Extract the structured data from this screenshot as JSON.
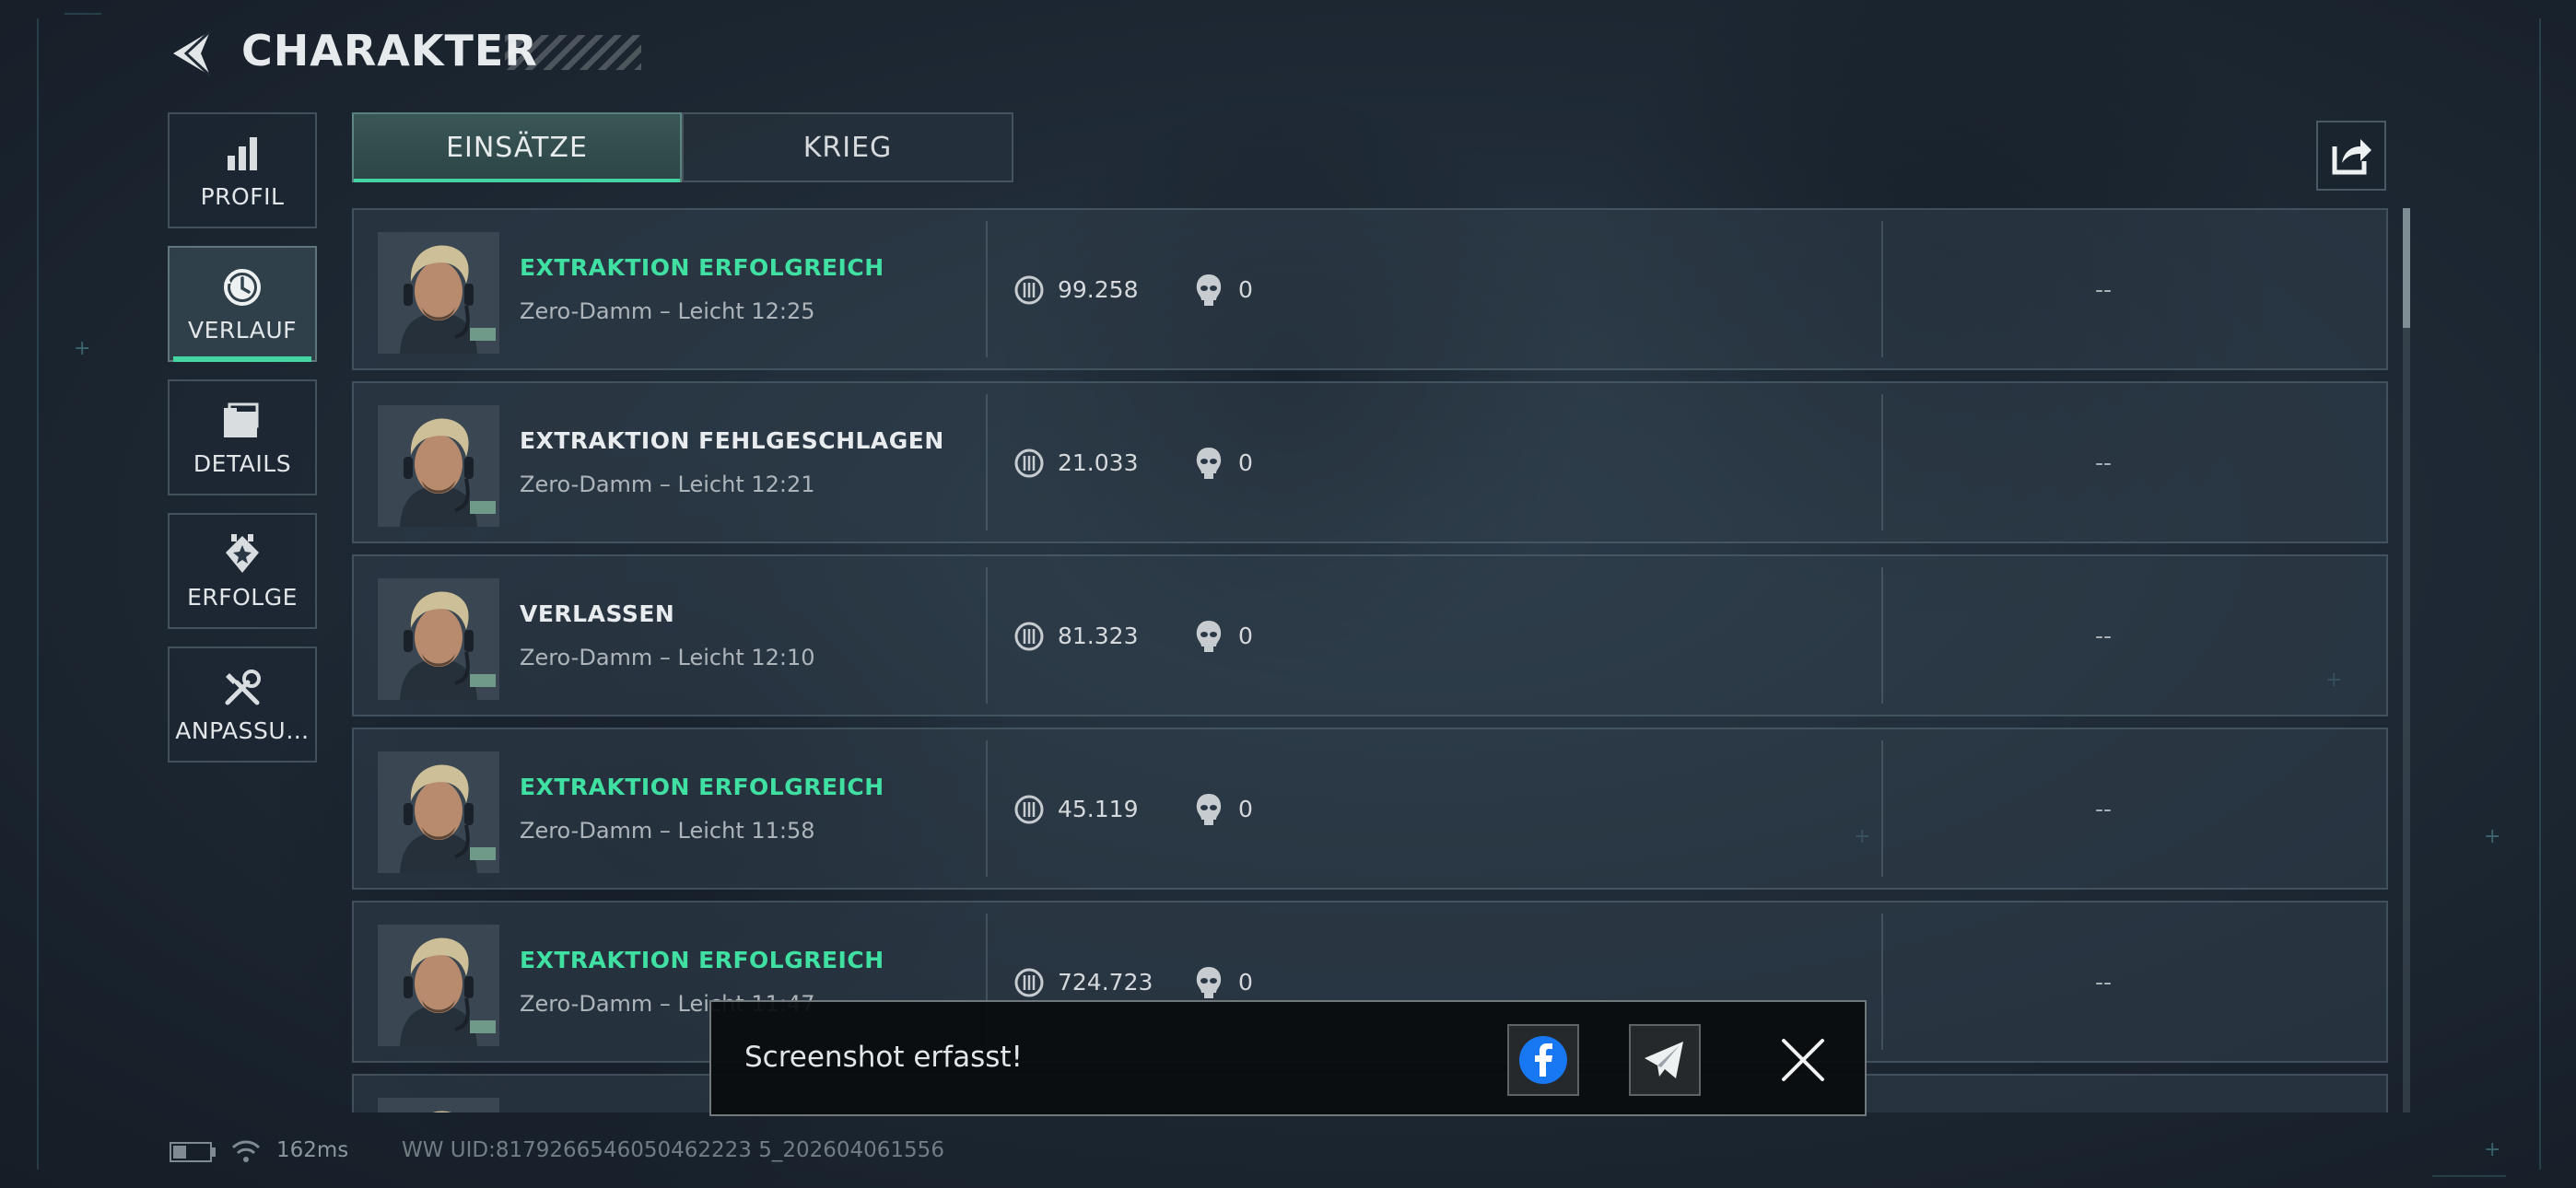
{
  "header": {
    "title": "CHARAKTER"
  },
  "sidebar": {
    "items": [
      {
        "label": "PROFIL",
        "icon": "bar-chart-icon",
        "active": false
      },
      {
        "label": "VERLAUF",
        "icon": "history-clock-icon",
        "active": true
      },
      {
        "label": "DETAILS",
        "icon": "folders-icon",
        "active": false
      },
      {
        "label": "ERFOLGE",
        "icon": "achievement-badge-icon",
        "active": false
      },
      {
        "label": "ANPASSU…",
        "icon": "wrench-screwdriver-icon",
        "active": false
      }
    ]
  },
  "tabs": [
    {
      "label": "EINSÄTZE",
      "active": true
    },
    {
      "label": "KRIEG",
      "active": false
    }
  ],
  "share": {
    "icon": "share-export-icon"
  },
  "matches": [
    {
      "status": "EXTRAKTION ERFOLGREICH",
      "status_type": "success",
      "subtitle": "Zero-Damm – Leicht 12:25",
      "value": "99.258",
      "kills": "0",
      "extra": "--"
    },
    {
      "status": "EXTRAKTION FEHLGESCHLAGEN",
      "status_type": "failed",
      "subtitle": "Zero-Damm – Leicht 12:21",
      "value": "21.033",
      "kills": "0",
      "extra": "--"
    },
    {
      "status": "VERLASSEN",
      "status_type": "left",
      "subtitle": "Zero-Damm – Leicht 12:10",
      "value": "81.323",
      "kills": "0",
      "extra": "--"
    },
    {
      "status": "EXTRAKTION ERFOLGREICH",
      "status_type": "success",
      "subtitle": "Zero-Damm – Leicht 11:58",
      "value": "45.119",
      "kills": "0",
      "extra": "--"
    },
    {
      "status": "EXTRAKTION ERFOLGREICH",
      "status_type": "success",
      "subtitle": "Zero-Damm – Leicht 11:47",
      "value": "724.723",
      "kills": "0",
      "extra": "--"
    }
  ],
  "toast": {
    "message": "Screenshot erfasst!",
    "buttons": [
      "facebook-icon",
      "telegram-icon",
      "close-icon"
    ]
  },
  "footer": {
    "ping": "162ms",
    "uid": "WW UID:8179266546050462223 5_202604061556"
  },
  "colors": {
    "accent": "#44d6a0",
    "background": "#1f2a36",
    "toast_bg": "#0a0c0e"
  }
}
